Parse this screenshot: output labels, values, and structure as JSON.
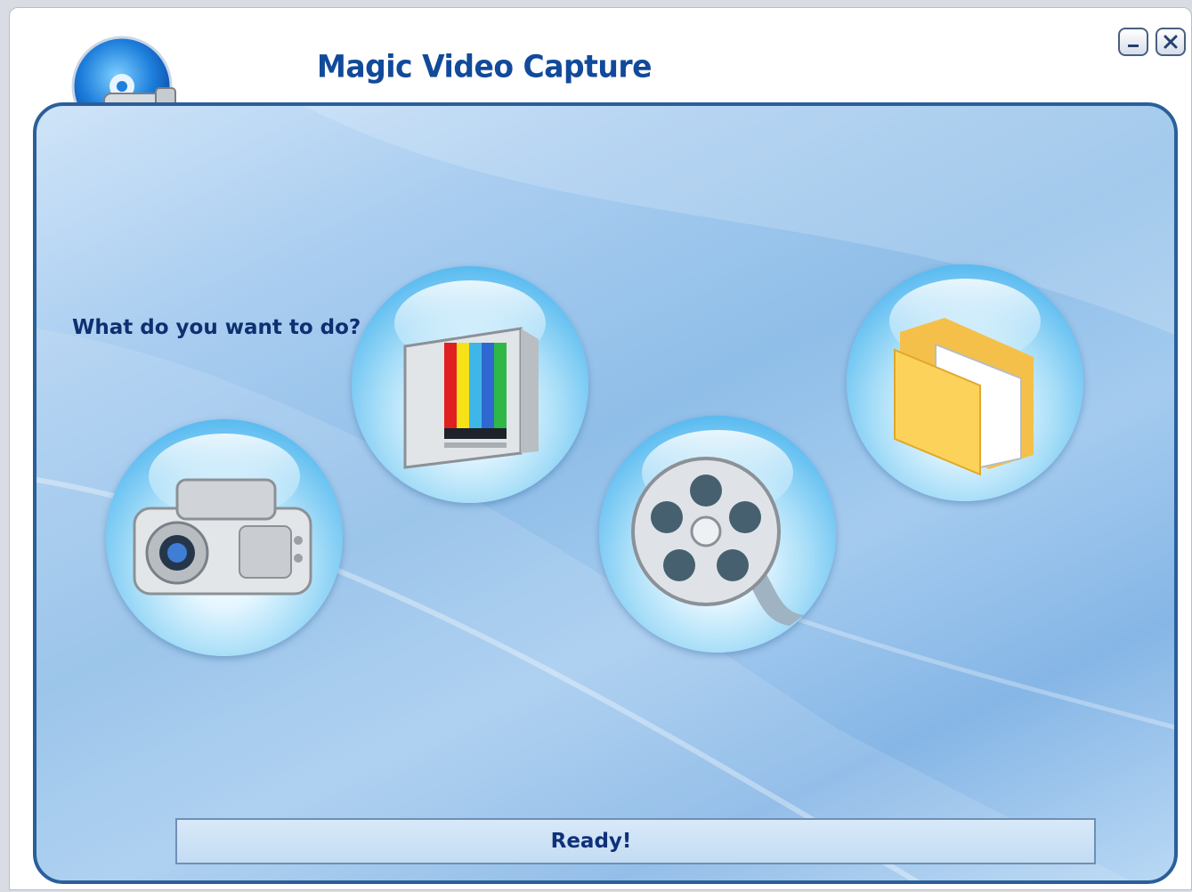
{
  "app": {
    "title": "Magic Video Capture"
  },
  "window_controls": {
    "minimize_icon": "minimize-icon",
    "close_icon": "close-icon"
  },
  "main": {
    "prompt": "What do you want to do?",
    "actions": [
      {
        "icon": "camcorder-icon"
      },
      {
        "icon": "tv-icon"
      },
      {
        "icon": "film-reel-icon"
      },
      {
        "icon": "folder-icon"
      }
    ]
  },
  "status": {
    "text": "Ready!"
  },
  "colors": {
    "title": "#114a9a",
    "prompt": "#0e2f70",
    "panel_border": "#2a5f9a"
  }
}
